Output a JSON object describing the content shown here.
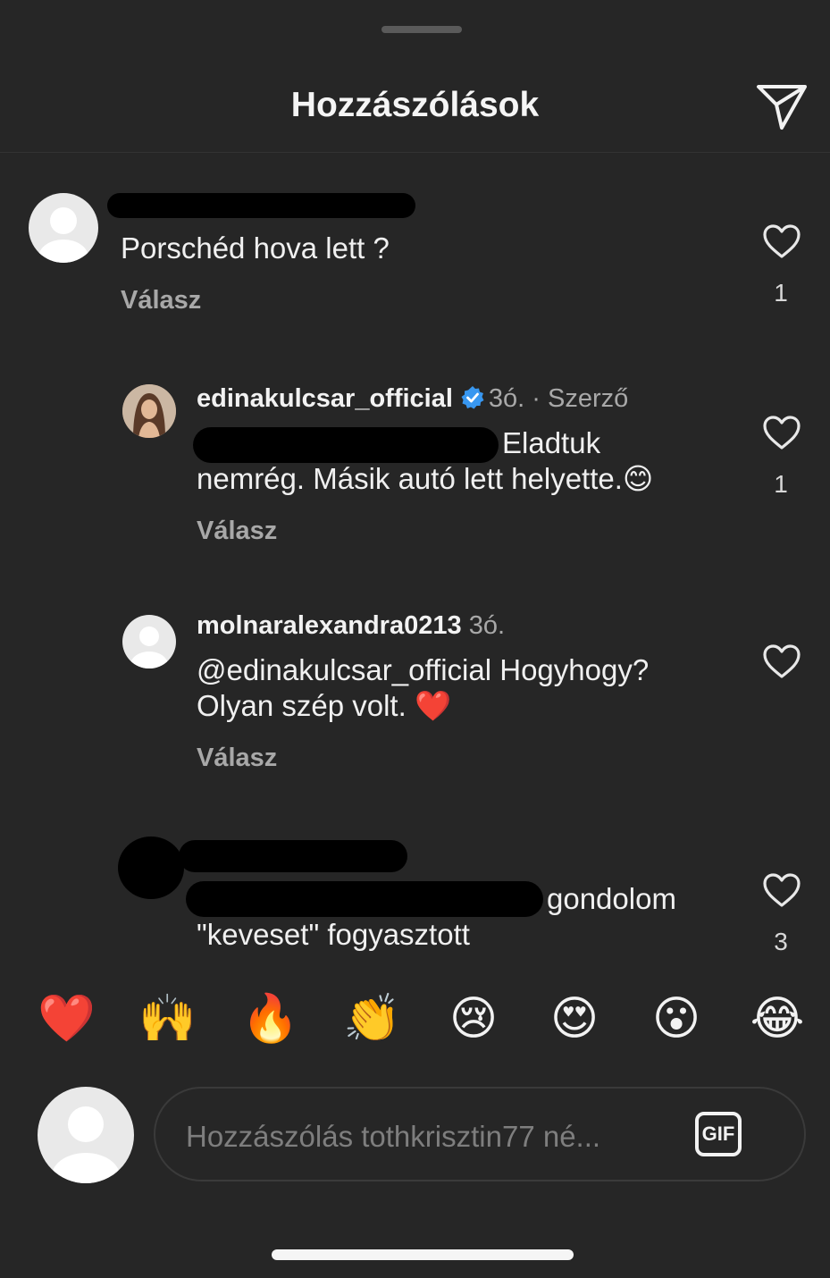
{
  "header": {
    "title": "Hozzászólások",
    "send_icon": "paper-plane-icon"
  },
  "comments": [
    {
      "username": "",
      "text": "Porschéd hova lett ?",
      "reply_label": "Válasz",
      "likes": "1",
      "username_redacted": true
    },
    {
      "username": "edinakulcsar_official",
      "verified": true,
      "time": "3ó.",
      "meta_suffix": "· Szerző",
      "text_line1": "Eladtuk",
      "text_line2": "nemrég. Másik autó lett helyette.😊",
      "reply_label": "Válasz",
      "likes": "1"
    },
    {
      "username": "molnaralexandra0213",
      "time": "3ó.",
      "text_line1": "@edinakulcsar_official Hogyhogy?",
      "text_line2": "Olyan szép volt. ❤️",
      "reply_label": "Válasz",
      "likes": ""
    },
    {
      "username": "",
      "text_line1": "gondolom",
      "text_line2": "\"keveset\" fogyasztott",
      "likes": "3",
      "username_redacted": true
    }
  ],
  "reactions": [
    "❤️",
    "🙌",
    "🔥",
    "👏",
    "😢",
    "😍",
    "😮",
    "😂"
  ],
  "composer": {
    "placeholder": "Hozzászólás tothkrisztin77 né...",
    "gif_label": "GIF"
  },
  "colors": {
    "background": "#262626",
    "verified": "#3897f0",
    "heart_red": "#ed1c24"
  }
}
